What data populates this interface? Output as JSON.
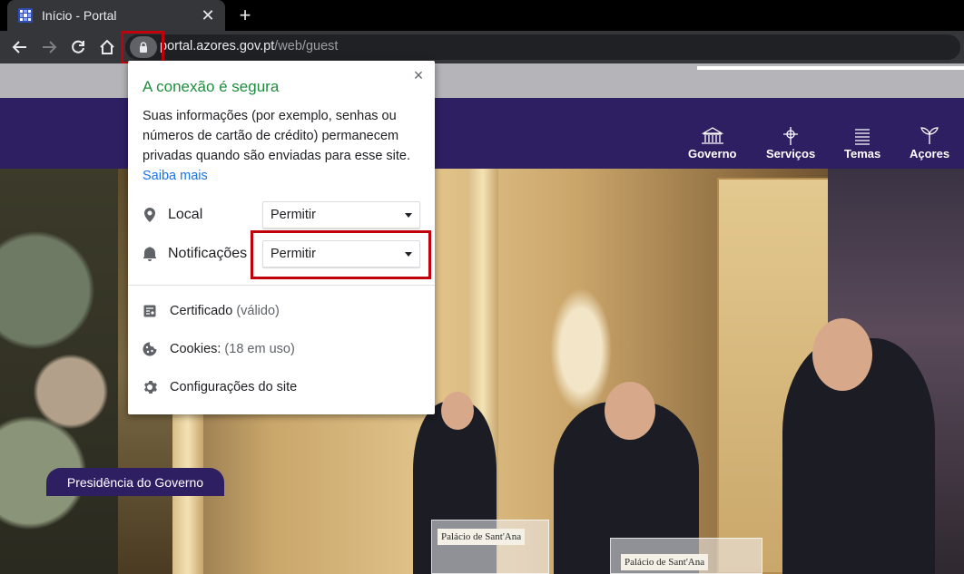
{
  "browser": {
    "tab": {
      "title": "Início - Portal"
    },
    "newtab_label": "+",
    "url": {
      "domain": "portal.azores.gov.pt",
      "path": "/web/guest"
    }
  },
  "site": {
    "nav": [
      {
        "label": "Governo",
        "icon": "building-icon"
      },
      {
        "label": "Serviços",
        "icon": "compass-icon"
      },
      {
        "label": "Temas",
        "icon": "list-icon"
      },
      {
        "label": "Açores",
        "icon": "plant-icon"
      }
    ],
    "hero": {
      "podium_label_1": "Palácio de Sant'Ana",
      "podium_label_2": "Palácio de Sant'Ana"
    },
    "presidencia_label": "Presidência do Governo"
  },
  "popup": {
    "title": "A conexão é segura",
    "description": "Suas informações (por exemplo, senhas ou números de cartão de crédito) permanecem privadas quando são enviadas para esse site.",
    "learn_more": "Saiba mais",
    "close_glyph": "×",
    "permissions": [
      {
        "label": "Local",
        "value": "Permitir",
        "icon": "location-pin-icon"
      },
      {
        "label": "Notificações",
        "value": "Permitir",
        "icon": "bell-icon"
      }
    ],
    "items": [
      {
        "label": "Certificado",
        "sub": "(válido)",
        "icon": "certificate-icon"
      },
      {
        "label": "Cookies:",
        "sub": "(18 em uso)",
        "icon": "cookie-icon"
      },
      {
        "label": "Configurações do site",
        "sub": "",
        "icon": "gear-icon"
      }
    ]
  },
  "colors": {
    "brand_purple": "#2e1f63",
    "secure_green": "#1e8e3e",
    "link_blue": "#1a73e8",
    "highlight_red": "#c0000b"
  }
}
